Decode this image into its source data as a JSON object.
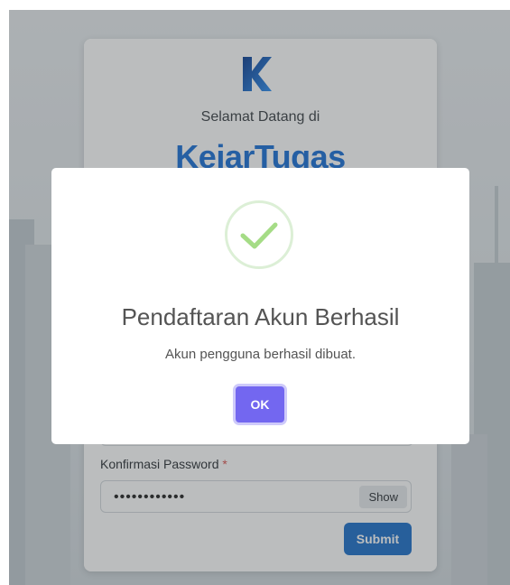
{
  "login_card": {
    "welcome_text": "Selamat Datang di",
    "brand_name": "KejarTugas",
    "confirm_password_label": "Konfirmasi Password",
    "required_marker": "*",
    "confirm_password_value": "••••••••••••",
    "show_button_label": "Show",
    "submit_button_label": "Submit",
    "brand_color": "#1a6fd6"
  },
  "modal": {
    "icon": "success-check-icon",
    "title": "Pendaftaran Akun Berhasil",
    "message": "Akun pengguna berhasil dibuat.",
    "ok_button_label": "OK",
    "ok_color": "#7367f0",
    "check_color": "#a5dc86"
  }
}
